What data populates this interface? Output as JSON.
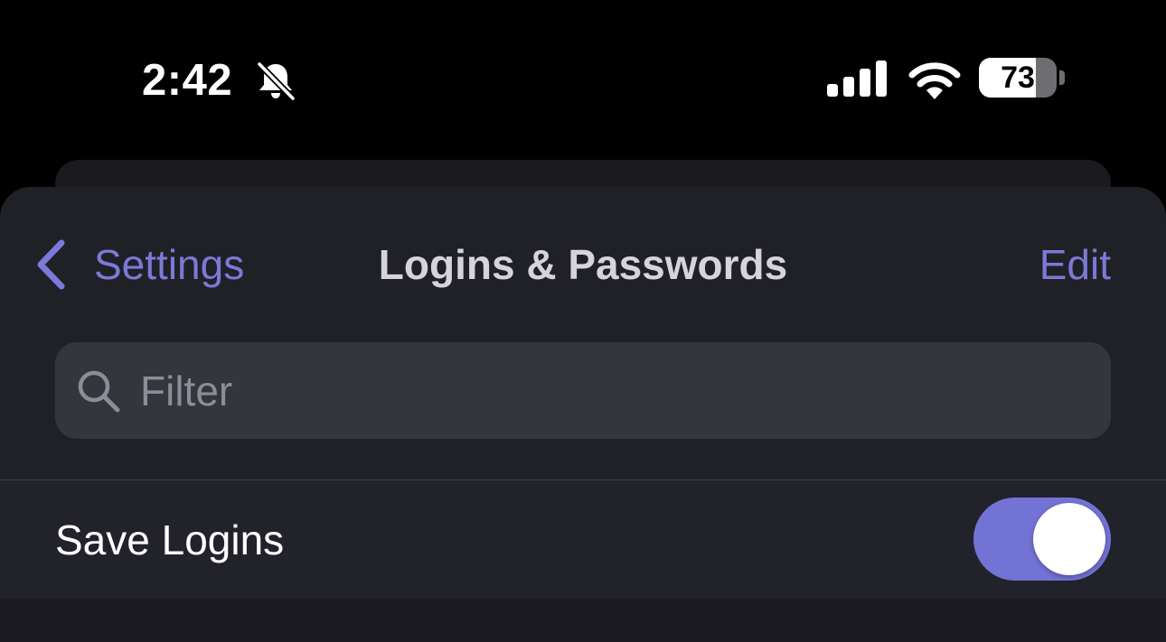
{
  "status_bar": {
    "time": "2:42",
    "battery_percent": "73",
    "battery_level": 0.73,
    "icons": [
      "bell-slash-icon",
      "cellular-signal-icon",
      "wifi-icon",
      "battery-icon"
    ]
  },
  "nav": {
    "back_label": "Settings",
    "title": "Logins & Passwords",
    "edit_label": "Edit"
  },
  "filter": {
    "placeholder": "Filter",
    "value": ""
  },
  "settings": {
    "save_logins": {
      "label": "Save Logins",
      "enabled": true
    }
  },
  "colors": {
    "accent": "#7373d6",
    "link": "#7b7ad8",
    "background": "#000000",
    "sheet": "#202027",
    "field": "#35353e"
  }
}
